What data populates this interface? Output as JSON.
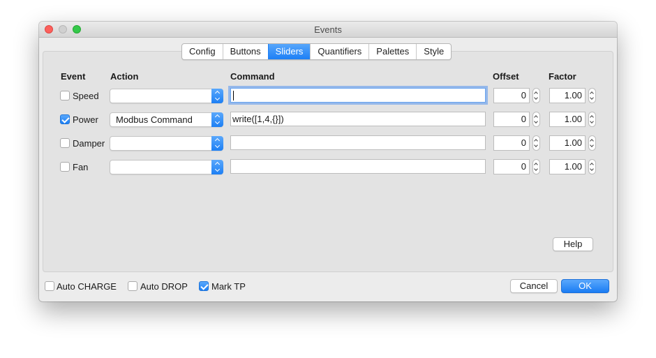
{
  "window": {
    "title": "Events"
  },
  "tabs": [
    {
      "label": "Config",
      "active": false
    },
    {
      "label": "Buttons",
      "active": false
    },
    {
      "label": "Sliders",
      "active": true
    },
    {
      "label": "Quantifiers",
      "active": false
    },
    {
      "label": "Palettes",
      "active": false
    },
    {
      "label": "Style",
      "active": false
    }
  ],
  "headers": {
    "event": "Event",
    "action": "Action",
    "command": "Command",
    "offset": "Offset",
    "factor": "Factor"
  },
  "rows": [
    {
      "event": "Speed",
      "checked": false,
      "action": "",
      "command": "",
      "offset": "0",
      "factor": "1.00"
    },
    {
      "event": "Power",
      "checked": true,
      "action": "Modbus Command",
      "command": "write([1,4,{}])",
      "offset": "0",
      "factor": "1.00"
    },
    {
      "event": "Damper",
      "checked": false,
      "action": "",
      "command": "",
      "offset": "0",
      "factor": "1.00"
    },
    {
      "event": "Fan",
      "checked": false,
      "action": "",
      "command": "",
      "offset": "0",
      "factor": "1.00"
    }
  ],
  "help_label": "Help",
  "footer": {
    "options": [
      {
        "label": "Auto CHARGE",
        "checked": false
      },
      {
        "label": "Auto DROP",
        "checked": false
      },
      {
        "label": "Mark TP",
        "checked": true
      }
    ],
    "cancel_label": "Cancel",
    "ok_label": "OK"
  },
  "colors": {
    "accent": "#1d7ff4",
    "close": "#fc605c",
    "maximize": "#34c84a"
  }
}
